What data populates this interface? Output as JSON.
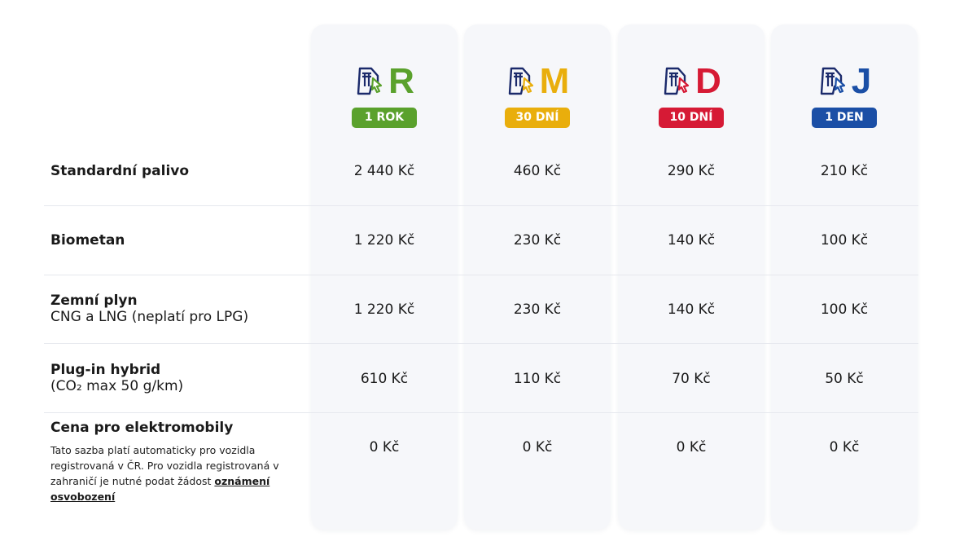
{
  "plans": [
    {
      "letter": "R",
      "badge": "1 ROK",
      "color": "#5aa12c",
      "icon": "highway-cursor-icon"
    },
    {
      "letter": "M",
      "badge": "30 DNÍ",
      "color": "#e9ae0c",
      "icon": "highway-cursor-icon"
    },
    {
      "letter": "D",
      "badge": "10 DNÍ",
      "color": "#d61a35",
      "icon": "highway-cursor-icon"
    },
    {
      "letter": "J",
      "badge": "1 DEN",
      "color": "#1b4fa6",
      "icon": "highway-cursor-icon"
    }
  ],
  "rows": [
    {
      "title": "Standardní palivo",
      "prices": [
        "2 440 Kč",
        "460 Kč",
        "290 Kč",
        "210 Kč"
      ]
    },
    {
      "title": "Biometan",
      "prices": [
        "1 220 Kč",
        "230 Kč",
        "140 Kč",
        "100 Kč"
      ]
    },
    {
      "title": "Zemní plyn",
      "subtitle": "CNG a LNG (neplatí pro LPG)",
      "prices": [
        "1 220 Kč",
        "230 Kč",
        "140 Kč",
        "100 Kč"
      ]
    },
    {
      "title": "Plug-in hybrid",
      "subtitle": "(CO₂ max 50 g/km)",
      "prices": [
        "610 Kč",
        "110 Kč",
        "70 Kč",
        "50 Kč"
      ]
    },
    {
      "title": "Cena pro elektromobily",
      "note": "Tato sazba platí automaticky pro vozidla registrovaná v ČR. Pro vozidla registrovaná v zahraničí je nutné podat žádost ",
      "link": "oznámení osvobození",
      "prices": [
        "0 Kč",
        "0 Kč",
        "0 Kč",
        "0 Kč"
      ]
    }
  ],
  "icon_color": "#1b2a6b"
}
